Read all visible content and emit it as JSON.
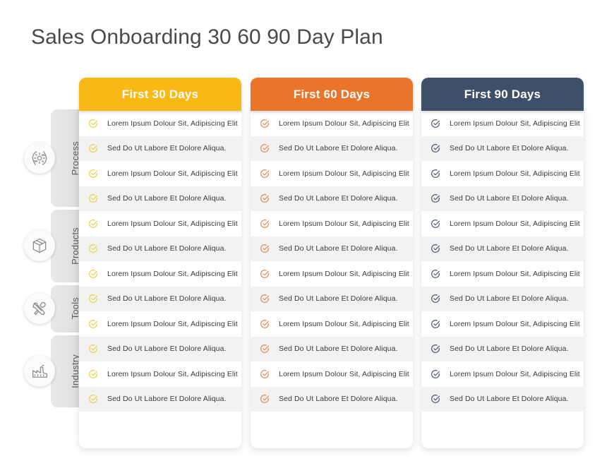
{
  "title": "Sales Onboarding 30 60 90 Day Plan",
  "text_a": "Lorem Ipsum Dolour Sit, Adipiscing Elit",
  "text_b": "Sed Do Ut Labore Et Dolore Aliqua.",
  "colors": {
    "col1_header": "#F9B814",
    "col2_header": "#E8752A",
    "col3_header": "#3E5068",
    "col1_check": "#E8D24A",
    "col2_check": "#E08A52",
    "col3_check": "#4A5A70",
    "title": "#4A4A4A",
    "row_alt": "#F2F2F2",
    "row_plain": "#FFFFFF",
    "tab_gray": "#E2E2E2"
  },
  "categories": [
    {
      "label": "Process",
      "icon": "gear-settings-icon",
      "rows": 4
    },
    {
      "label": "Products",
      "icon": "box-package-icon",
      "rows": 3
    },
    {
      "label": "Tools",
      "icon": "tools-wrench-screwdriver-icon",
      "rows": 2
    },
    {
      "label": "Industry",
      "icon": "factory-industry-icon",
      "rows": 3
    }
  ],
  "columns": [
    {
      "header": "First 30 Days",
      "header_color": "#F9B814",
      "check_color": "#E8D24A",
      "items": [
        "Lorem Ipsum Dolour Sit, Adipiscing Elit",
        "Sed Do Ut Labore Et Dolore Aliqua.",
        "Lorem Ipsum Dolour Sit, Adipiscing Elit",
        "Sed Do Ut Labore Et Dolore Aliqua.",
        "Lorem Ipsum Dolour Sit, Adipiscing Elit",
        "Sed Do Ut Labore Et Dolore Aliqua.",
        "Lorem Ipsum Dolour Sit, Adipiscing Elit",
        "Sed Do Ut Labore Et Dolore Aliqua.",
        "Lorem Ipsum Dolour Sit, Adipiscing Elit",
        "Sed Do Ut Labore Et Dolore Aliqua.",
        "Lorem Ipsum Dolour Sit, Adipiscing Elit",
        "Sed Do Ut Labore Et Dolore Aliqua."
      ]
    },
    {
      "header": "First 60 Days",
      "header_color": "#E8752A",
      "check_color": "#E08A52",
      "items": [
        "Lorem Ipsum Dolour Sit, Adipiscing Elit",
        "Sed Do Ut Labore Et Dolore Aliqua.",
        "Lorem Ipsum Dolour Sit, Adipiscing Elit",
        "Sed Do Ut Labore Et Dolore Aliqua.",
        "Lorem Ipsum Dolour Sit, Adipiscing Elit",
        "Sed Do Ut Labore Et Dolore Aliqua.",
        "Lorem Ipsum Dolour Sit, Adipiscing Elit",
        "Sed Do Ut Labore Et Dolore Aliqua.",
        "Lorem Ipsum Dolour Sit, Adipiscing Elit",
        "Sed Do Ut Labore Et Dolore Aliqua.",
        "Lorem Ipsum Dolour Sit, Adipiscing Elit",
        "Sed Do Ut Labore Et Dolore Aliqua."
      ]
    },
    {
      "header": "First 90 Days",
      "header_color": "#3E5068",
      "check_color": "#4A5A70",
      "items": [
        "Lorem Ipsum Dolour Sit, Adipiscing Elit",
        "Sed Do Ut Labore Et Dolore Aliqua.",
        "Lorem Ipsum Dolour Sit, Adipiscing Elit",
        "Sed Do Ut Labore Et Dolore Aliqua.",
        "Lorem Ipsum Dolour Sit, Adipiscing Elit",
        "Sed Do Ut Labore Et Dolore Aliqua.",
        "Lorem Ipsum Dolour Sit, Adipiscing Elit",
        "Sed Do Ut Labore Et Dolore Aliqua.",
        "Lorem Ipsum Dolour Sit, Adipiscing Elit",
        "Sed Do Ut Labore Et Dolore Aliqua.",
        "Lorem Ipsum Dolour Sit, Adipiscing Elit",
        "Sed Do Ut Labore Et Dolore Aliqua."
      ]
    }
  ]
}
